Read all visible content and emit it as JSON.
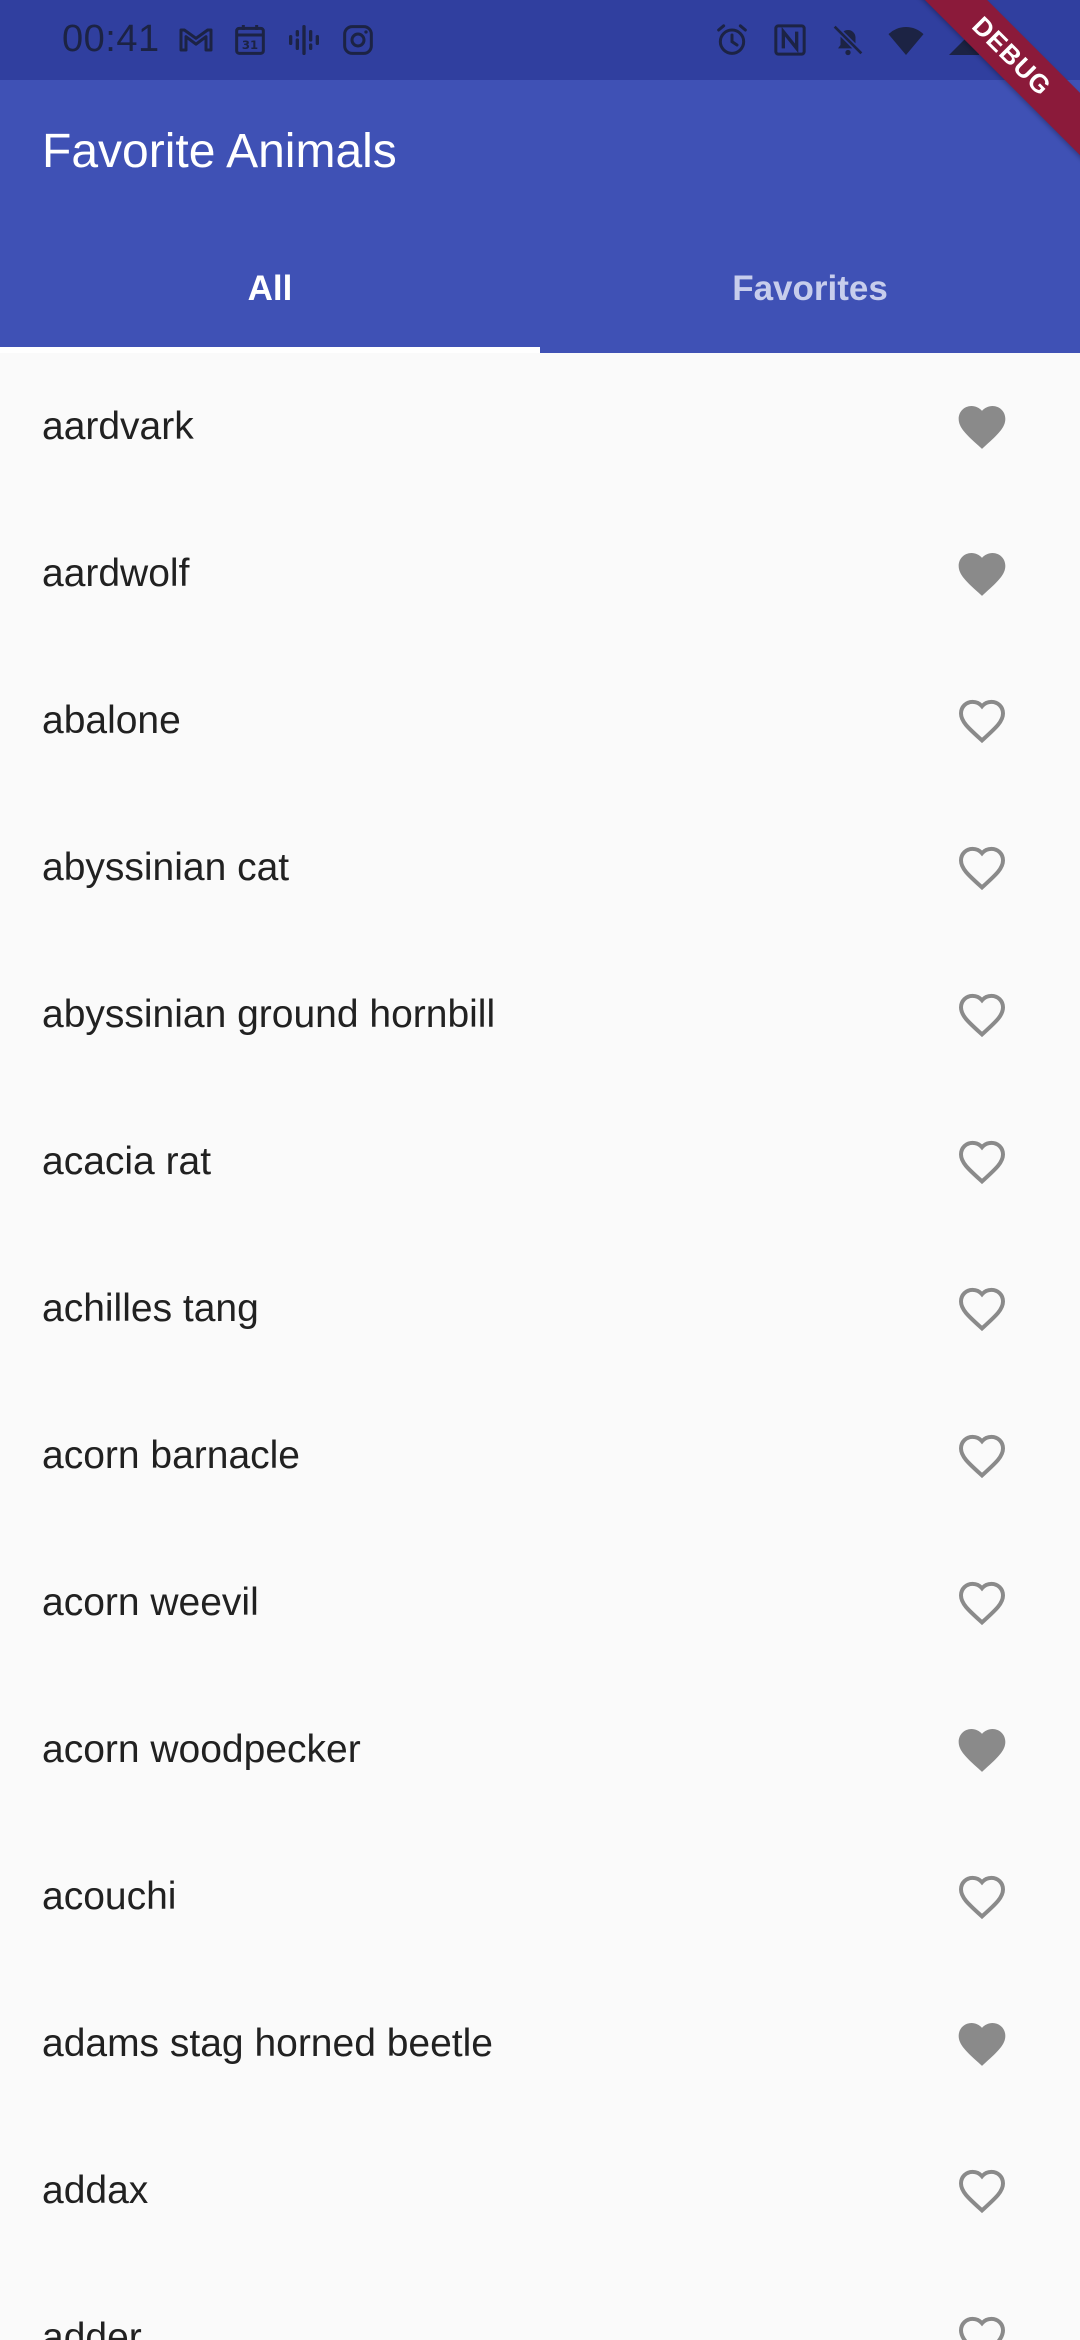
{
  "status_bar": {
    "time": "00:41",
    "left_icons": [
      "gmail-icon",
      "calendar-icon",
      "podcast-icon",
      "instagram-icon"
    ],
    "right_icons": [
      "alarm-icon",
      "nfc-icon",
      "bell-off-icon",
      "wifi-icon",
      "signal-icon"
    ]
  },
  "debug_banner": "DEBUG",
  "app_bar": {
    "title": "Favorite Animals",
    "background": "#3f51b5"
  },
  "tabs": [
    {
      "label": "All",
      "selected": true
    },
    {
      "label": "Favorites",
      "selected": false
    }
  ],
  "colors": {
    "primary": "#3f51b5",
    "status_bar": "#303f9f",
    "heart": "#8a8a8a",
    "ribbon": "#8b1a3a"
  },
  "animals": [
    {
      "name": "aardvark",
      "favorite": true
    },
    {
      "name": "aardwolf",
      "favorite": true
    },
    {
      "name": "abalone",
      "favorite": false
    },
    {
      "name": "abyssinian cat",
      "favorite": false
    },
    {
      "name": "abyssinian ground hornbill",
      "favorite": false
    },
    {
      "name": "acacia rat",
      "favorite": false
    },
    {
      "name": "achilles tang",
      "favorite": false
    },
    {
      "name": "acorn barnacle",
      "favorite": false
    },
    {
      "name": "acorn weevil",
      "favorite": false
    },
    {
      "name": "acorn woodpecker",
      "favorite": true
    },
    {
      "name": "acouchi",
      "favorite": false
    },
    {
      "name": "adams stag horned beetle",
      "favorite": true
    },
    {
      "name": "addax",
      "favorite": false
    },
    {
      "name": "adder",
      "favorite": false
    }
  ]
}
